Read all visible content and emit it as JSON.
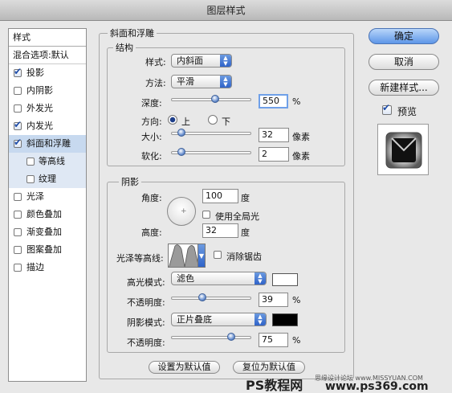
{
  "window": {
    "title": "图层样式"
  },
  "sidebar": {
    "header": "样式",
    "blend": "混合选项:默认",
    "items": [
      {
        "label": "投影",
        "checked": true
      },
      {
        "label": "内阴影",
        "checked": false
      },
      {
        "label": "外发光",
        "checked": false
      },
      {
        "label": "内发光",
        "checked": true
      },
      {
        "label": "斜面和浮雕",
        "checked": true
      },
      {
        "label": "等高线",
        "checked": false
      },
      {
        "label": "纹理",
        "checked": false
      },
      {
        "label": "光泽",
        "checked": false
      },
      {
        "label": "颜色叠加",
        "checked": false
      },
      {
        "label": "渐变叠加",
        "checked": false
      },
      {
        "label": "图案叠加",
        "checked": false
      },
      {
        "label": "描边",
        "checked": false
      }
    ]
  },
  "bevel": {
    "title": "斜面和浮雕",
    "structure": {
      "title": "结构",
      "style_label": "样式:",
      "style_value": "内斜面",
      "technique_label": "方法:",
      "technique_value": "平滑",
      "depth_label": "深度:",
      "depth_value": "550",
      "depth_unit": "%",
      "direction_label": "方向:",
      "dir_up": "上",
      "dir_down": "下",
      "size_label": "大小:",
      "size_value": "32",
      "size_unit": "像素",
      "soften_label": "软化:",
      "soften_value": "2",
      "soften_unit": "像素"
    },
    "shading": {
      "title": "阴影",
      "angle_label": "角度:",
      "angle_value": "100",
      "angle_unit": "度",
      "global_light_label": "使用全局光",
      "altitude_label": "高度:",
      "altitude_value": "32",
      "altitude_unit": "度",
      "gloss_contour_label": "光泽等高线:",
      "antialias_label": "消除锯齿",
      "highlight_mode_label": "高光模式:",
      "highlight_mode_value": "滤色",
      "highlight_color": "#ffffff",
      "highlight_opacity_label": "不透明度:",
      "highlight_opacity_value": "39",
      "highlight_opacity_unit": "%",
      "shadow_mode_label": "阴影模式:",
      "shadow_mode_value": "正片叠底",
      "shadow_color": "#000000",
      "shadow_opacity_label": "不透明度:",
      "shadow_opacity_value": "75",
      "shadow_opacity_unit": "%"
    },
    "set_default": "设置为默认值",
    "reset_default": "复位为默认值"
  },
  "right": {
    "ok": "确定",
    "cancel": "取消",
    "new_style": "新建样式...",
    "preview_label": "预览"
  },
  "watermark": {
    "left": "PS教程网",
    "right": "思缘设计论坛 www.MISSYUAN.COM",
    "url": "www.ps369.com"
  }
}
